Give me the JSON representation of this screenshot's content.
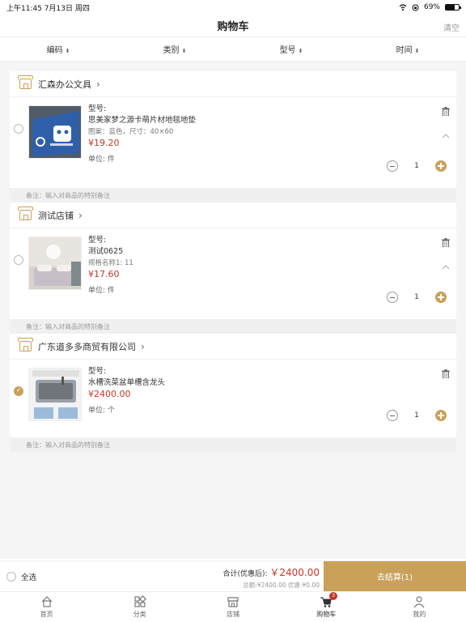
{
  "status_bar": {
    "time_date": "上午11:45   7月13日 周四",
    "battery": "69%",
    "battery_level": 0.69
  },
  "navbar": {
    "title": "购物车",
    "clear_label": "清空"
  },
  "sort": [
    {
      "label": "编码"
    },
    {
      "label": "类别"
    },
    {
      "label": "型号"
    },
    {
      "label": "时间"
    }
  ],
  "shops": [
    {
      "name": "汇森办公文具",
      "checked": false,
      "item": {
        "model_label": "型号:",
        "name": "思美家梦之源卡萌片材地毯地垫",
        "spec": "图案：蓝色，尺寸：40×60",
        "price": "¥19.20",
        "unit": "单位:  件",
        "qty": "1"
      },
      "remark": "备注：输入对商品的特别备注"
    },
    {
      "name": "测试店铺",
      "checked": false,
      "item": {
        "model_label": "型号:",
        "name": "测试0625",
        "spec": "规格名称1:  11",
        "price": "¥17.60",
        "unit": "单位:  件",
        "qty": "1"
      },
      "remark": "备注：输入对商品的特别备注"
    },
    {
      "name": "广东道多多商贸有限公司",
      "checked": true,
      "item": {
        "model_label": "型号:",
        "name": "水槽洗菜盆单槽含龙头",
        "price": "¥2400.00",
        "unit": "单位:  个",
        "qty": "1"
      },
      "remark": "备注：输入对商品的特别备注"
    }
  ],
  "bottom": {
    "select_all": "全选",
    "total_label": "合计(优惠后):",
    "total_amount": "￥2400.00",
    "sub_totals": "总额:¥2400.00  优惠:¥0.00",
    "checkout_label": "去结算(1)"
  },
  "tabs": [
    {
      "label": "首页",
      "icon": "home-icon"
    },
    {
      "label": "分类",
      "icon": "category-icon"
    },
    {
      "label": "店铺",
      "icon": "store-icon"
    },
    {
      "label": "购物车",
      "icon": "cart-icon",
      "badge": "3"
    },
    {
      "label": "我的",
      "icon": "user-icon"
    }
  ],
  "colors": {
    "accent": "#c9a15b",
    "price": "#c0392b"
  }
}
